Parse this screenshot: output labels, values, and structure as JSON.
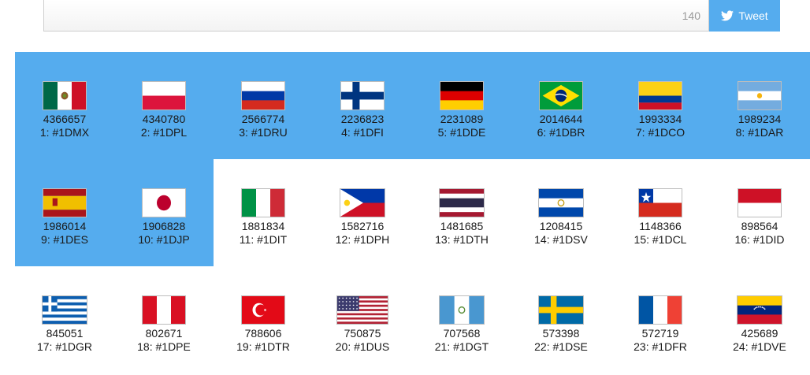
{
  "tweet": {
    "char_count": "140",
    "button_label": "Tweet"
  },
  "countries": [
    {
      "rank_tag": "1: #1DMX",
      "count": "4366657",
      "flag": "mexico-flag"
    },
    {
      "rank_tag": "2: #1DPL",
      "count": "4340780",
      "flag": "poland-flag"
    },
    {
      "rank_tag": "3: #1DRU",
      "count": "2566774",
      "flag": "russia-flag"
    },
    {
      "rank_tag": "4: #1DFI",
      "count": "2236823",
      "flag": "finland-flag"
    },
    {
      "rank_tag": "5: #1DDE",
      "count": "2231089",
      "flag": "germany-flag"
    },
    {
      "rank_tag": "6: #1DBR",
      "count": "2014644",
      "flag": "brazil-flag"
    },
    {
      "rank_tag": "7: #1DCO",
      "count": "1993334",
      "flag": "colombia-flag"
    },
    {
      "rank_tag": "8: #1DAR",
      "count": "1989234",
      "flag": "argentina-flag"
    },
    {
      "rank_tag": "9: #1DES",
      "count": "1986014",
      "flag": "spain-flag"
    },
    {
      "rank_tag": "10: #1DJP",
      "count": "1906828",
      "flag": "japan-flag"
    },
    {
      "rank_tag": "11: #1DIT",
      "count": "1881834",
      "flag": "italy-flag"
    },
    {
      "rank_tag": "12: #1DPH",
      "count": "1582716",
      "flag": "philippines-flag"
    },
    {
      "rank_tag": "13: #1DTH",
      "count": "1481685",
      "flag": "thailand-flag"
    },
    {
      "rank_tag": "14: #1DSV",
      "count": "1208415",
      "flag": "el-salvador-flag"
    },
    {
      "rank_tag": "15: #1DCL",
      "count": "1148366",
      "flag": "chile-flag"
    },
    {
      "rank_tag": "16: #1DID",
      "count": "898564",
      "flag": "indonesia-flag"
    },
    {
      "rank_tag": "17: #1DGR",
      "count": "845051",
      "flag": "greece-flag"
    },
    {
      "rank_tag": "18: #1DPE",
      "count": "802671",
      "flag": "peru-flag"
    },
    {
      "rank_tag": "19: #1DTR",
      "count": "788606",
      "flag": "turkey-flag"
    },
    {
      "rank_tag": "20: #1DUS",
      "count": "750875",
      "flag": "usa-flag"
    },
    {
      "rank_tag": "21: #1DGT",
      "count": "707568",
      "flag": "guatemala-flag"
    },
    {
      "rank_tag": "22: #1DSE",
      "count": "573398",
      "flag": "sweden-flag"
    },
    {
      "rank_tag": "23: #1DFR",
      "count": "572719",
      "flag": "france-flag"
    },
    {
      "rank_tag": "24: #1DVE",
      "count": "425689",
      "flag": "venezuela-flag"
    }
  ],
  "colors": {
    "highlight": "#55acee",
    "tweet_button": "#55acee"
  }
}
